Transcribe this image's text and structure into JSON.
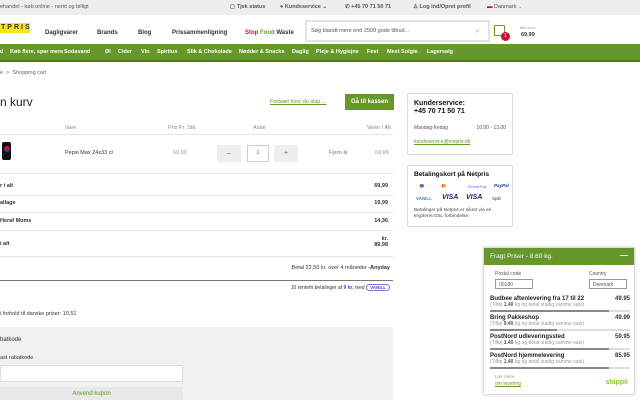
{
  "topbar": {
    "tagline": "ehandel - køb online - nemt og billigt",
    "check_status": "Tjek status",
    "customer_service": "Kundeservice",
    "phone": "+45 70 71 50 71",
    "login": "Log ind/Opret profil",
    "country": "Danmark"
  },
  "header": {
    "logo": "TPRIS",
    "menu": [
      "Dagligvarer",
      "Brands",
      "Blog",
      "Prissammenligning"
    ],
    "stop": "Stop",
    "food": "Food",
    "waste": "Waste",
    "search_placeholder": "Søg blandt mere end 2500 gode tilbud...",
    "cart_label": "Min Kurv",
    "cart_total": "69,99",
    "cart_count": "1"
  },
  "nav": [
    "d",
    "Køb flere, spar mere",
    "Sodavand",
    "Øl",
    "Cider",
    "Vin",
    "Spiritus",
    "Slik & Chokolade",
    "Nødder & Snacks",
    "Daglig",
    "Pleje & Hygiejne",
    "Fest",
    "Mest Solgte",
    "Lagersalg"
  ],
  "breadcrumb": {
    "home": "e",
    "sep": ">",
    "current": "Shopping cart"
  },
  "cart": {
    "title": "n kurv",
    "continue": "Fortsæt hvor du slap ...",
    "checkout": "Gå til kassen",
    "headers": {
      "item": "Vare",
      "price": "Pris Pr. Stk.",
      "qty": "Antal",
      "total": "Varer I Alt"
    },
    "items": [
      {
        "name": "Pepsi Max 24x33 cl",
        "price": "69,99",
        "qty": "1",
        "remove": "Fjern",
        "total": "69,99"
      }
    ],
    "summary": [
      {
        "label": "r i alt",
        "value": "69,99"
      },
      {
        "label": "allage",
        "value": "19,99"
      },
      {
        "label": "Heraf Moms",
        "value": "14,36"
      },
      {
        "label": "i alt",
        "value": "kr. 89,98"
      }
    ],
    "anyday": "Betal 22,50 kr. over 4 måneder",
    "anyday_brand": "-Anyday",
    "vanill_pre": "10 rentefri betalinger af",
    "vanill_amount": "9 kr.",
    "vanill_post": "med",
    "vanill_brand": "VANILL",
    "savings": "i forhold til danske priser: 10,51",
    "coupon_title": "batkode",
    "coupon_label": "ast rabatkode",
    "coupon_value": "",
    "coupon_button": "Anvend kupon"
  },
  "service": {
    "title": "Kunderservice:",
    "phone": "+45 70 71 50 71",
    "days": "Mandag-fredag",
    "hours": "10.00 - 13.00",
    "email": "kundeservice@netpris.dk"
  },
  "payment": {
    "title": "Betalingskort på Netpris",
    "logos": [
      "Maestro",
      "Mastercard",
      "MobilePay",
      "PayPal",
      "VANILL",
      "VISA",
      "VISA",
      "Split"
    ],
    "note": "Betalinger på Netpris er sikret via en krypteret SSL-forbindelse"
  },
  "shipping": {
    "title": "Fragt Priser - 8.60 kg.",
    "postal_label": "Postal code",
    "postal_value": "00180",
    "country_label": "Country",
    "country_value": "Denmark",
    "options": [
      {
        "name": "Budbee aftenlevering fra 17 til 22",
        "price": "49.95",
        "pre": "(Tilføj ",
        "kg": "1.40",
        "post": " kg og betal stadig samme sats)",
        "fill": 0.85
      },
      {
        "name": "Bring Pakkeshop",
        "price": "49.99",
        "pre": "(Tilføj ",
        "kg": "9.40",
        "post": " kg og betal stadig samme sats)",
        "fill": 0.48
      },
      {
        "name": "PostNord udleveringssted",
        "price": "59.95",
        "pre": "(Tilføj ",
        "kg": "1.40",
        "post": " kg og betal stadig samme sats)",
        "fill": 0.85
      },
      {
        "name": "PostNord hjemmelevering",
        "price": "85.95",
        "pre": "(Tilføj ",
        "kg": "1.40",
        "post": " kg og betal stadig samme sats)",
        "fill": 0.85
      }
    ],
    "read_more": "Lær mere",
    "about": "om levering",
    "brand": "shippii"
  },
  "colors": {
    "green": "#65972a",
    "yellow": "#f6e51a",
    "badge": "#c8102e"
  }
}
